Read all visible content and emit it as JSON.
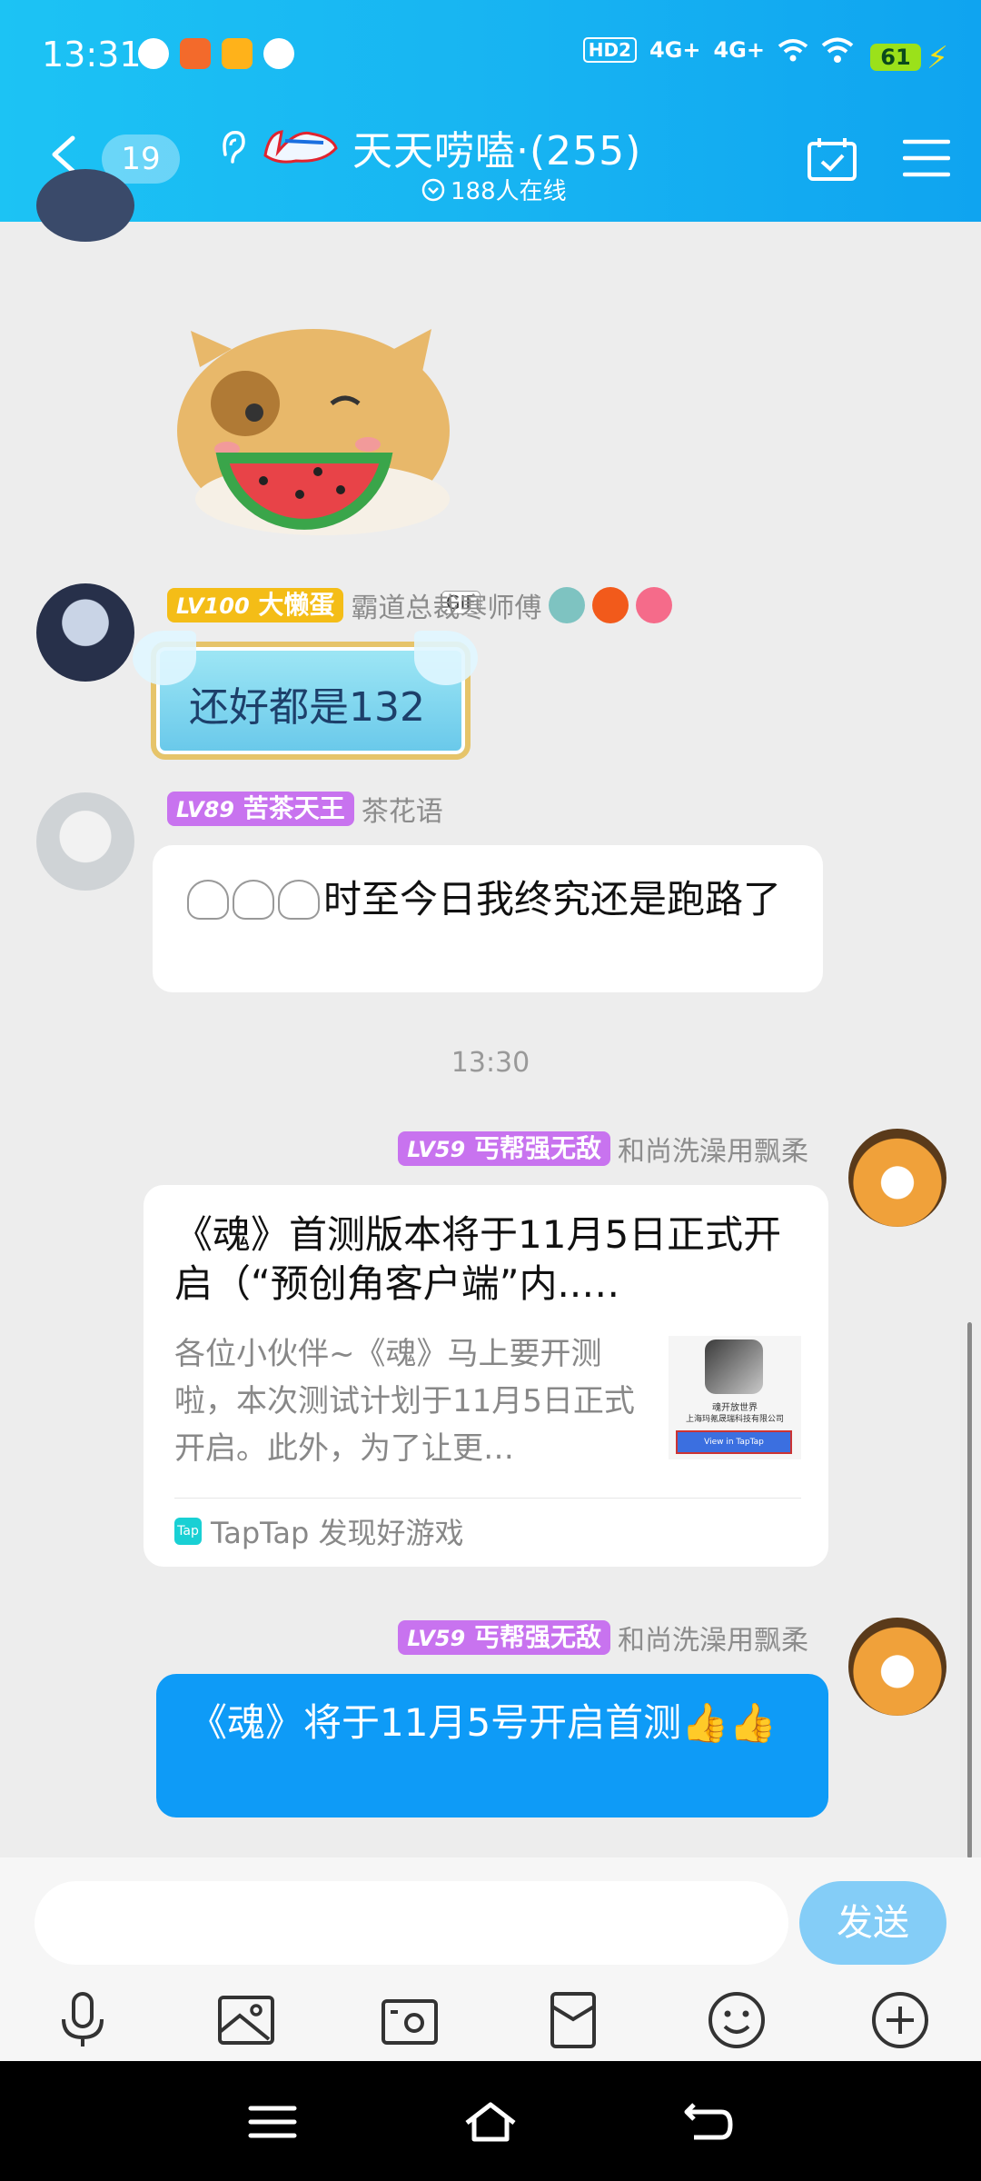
{
  "status_bar": {
    "time": "13:31",
    "network": [
      "HD2",
      "4G+",
      "4G+"
    ],
    "battery": "61"
  },
  "header": {
    "unread_count": "19",
    "title": "天天唠嗑·(255)",
    "online": "188人在线"
  },
  "messages": {
    "m1": {
      "level": "LV100",
      "badge": "大懒蛋",
      "name": "霸道总裁寒师傅",
      "text": "还好都是132"
    },
    "m2": {
      "level": "LV89",
      "badge": "苦茶天王",
      "name": "茶花语",
      "text": "时至今日我终究还是跑路了"
    },
    "time_separator": "13:30",
    "m3": {
      "level": "LV59",
      "badge": "丐帮强无敌",
      "name": "和尚洗澡用飘柔",
      "card_title": "《魂》首测版本将于11月5日正式开启（“预创角客户端”内..…",
      "card_desc": "各位小伙伴~《魂》马上要开测啦，本次测试计划于11月5日正式开启。此外，为了让更…",
      "card_source": "TapTap 发现好游戏",
      "thumb_caption": "魂开放世界",
      "thumb_company": "上海玛氪晟瑞科技有限公司",
      "thumb_button": "View in TapTap"
    },
    "m4": {
      "level": "LV59",
      "badge": "丐帮强无敌",
      "name": "和尚洗澡用飘柔",
      "text": "《魂》将于11月5号开启首测👍👍"
    }
  },
  "input": {
    "send_label": "发送"
  },
  "gif_label": "GIF",
  "colors": {
    "header_blue": "#17b3f2",
    "my_bubble": "#0e9bf7",
    "send_disabled": "#84cdf7",
    "badge_gold": "#f4bd17",
    "badge_purple": "#c873ef"
  }
}
